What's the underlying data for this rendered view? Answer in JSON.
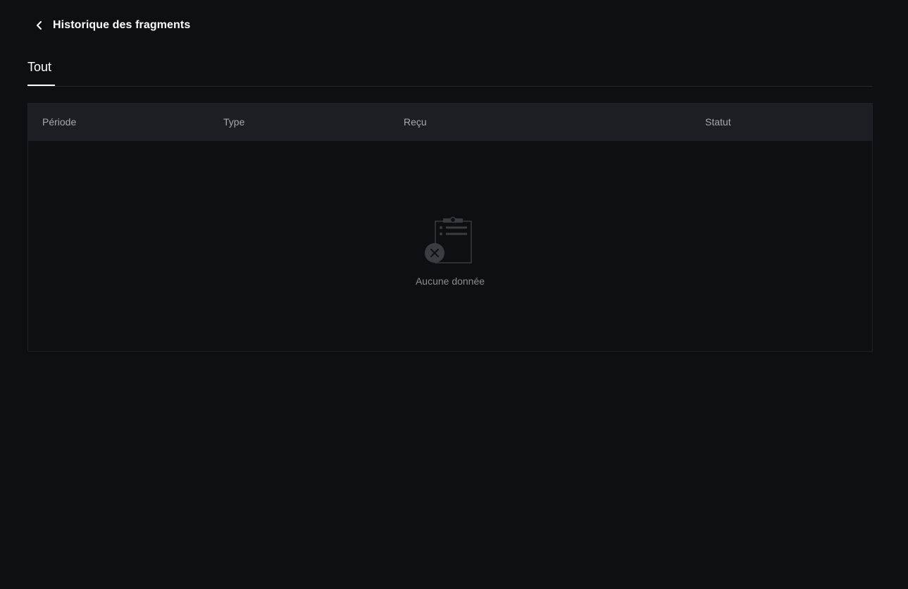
{
  "header": {
    "title": "Historique des fragments",
    "back_icon": "chevron-left-icon"
  },
  "tabs": [
    {
      "label": "Tout",
      "active": true
    }
  ],
  "table": {
    "columns": [
      "Période",
      "Type",
      "Reçu",
      "Statut"
    ],
    "rows": [],
    "empty": {
      "icon": "empty-clipboard-icon",
      "message": "Aucune donnée"
    }
  },
  "colors": {
    "background": "#0e0f11",
    "table_header": "#1d1e21",
    "header_text": "#a6a8ad",
    "muted_text": "#8a8c91",
    "active_tab": "#ffffff"
  }
}
